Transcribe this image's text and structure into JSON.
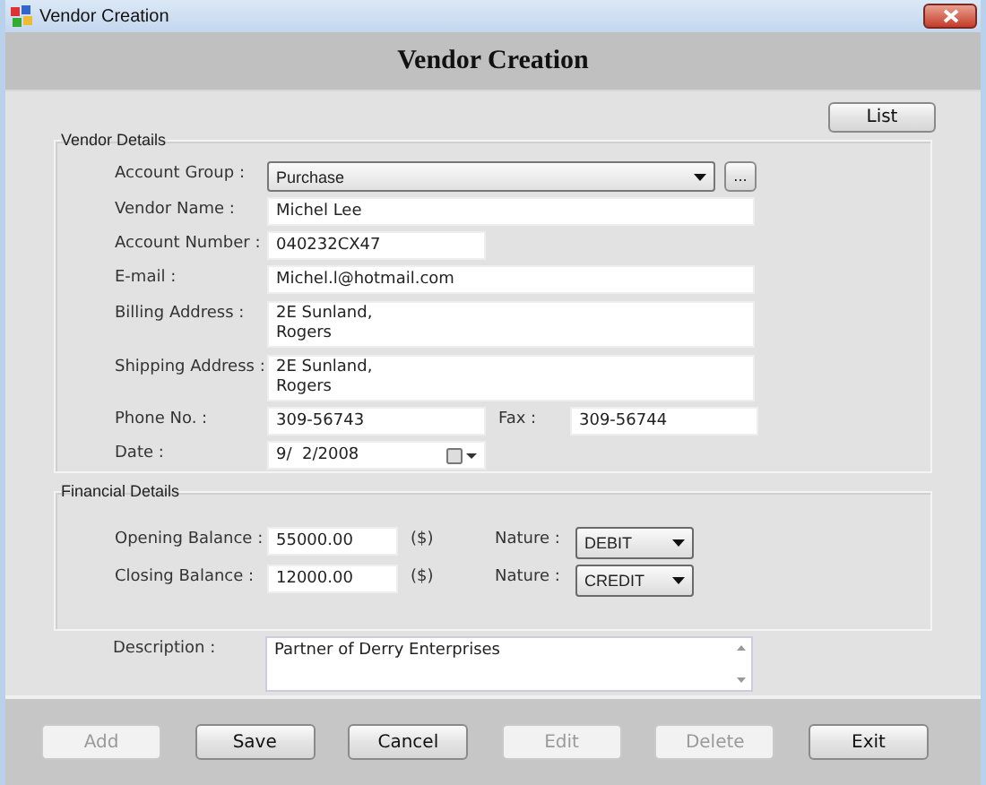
{
  "window": {
    "title": "Vendor Creation"
  },
  "header": {
    "title": "Vendor Creation"
  },
  "list_button": {
    "label": "List",
    "disabled": false
  },
  "vendor_details": {
    "legend": "Vendor Details",
    "fields": [
      {
        "kind": "combo",
        "label": "Account Group :",
        "value": "Purchase",
        "button": "..."
      },
      {
        "kind": "wide",
        "label": "Vendor Name :",
        "value": "Michel Lee"
      },
      {
        "kind": "short",
        "label": "Account Number :",
        "value": "040232CX47"
      },
      {
        "kind": "wide",
        "label": "E-mail :",
        "value": "Michel.l@hotmail.com"
      },
      {
        "kind": "multiline",
        "label": "Billing Address :",
        "value": "2E Sunland,\nRogers"
      },
      {
        "kind": "multiline",
        "label": "Shipping Address :",
        "value": "2E Sunland,\nRogers"
      },
      {
        "kind": "pair",
        "label": "Phone No. :",
        "value": "309-56743",
        "label2": "Fax :",
        "value2": "309-56744"
      },
      {
        "kind": "date",
        "label": "Date :",
        "value": "9/  2/2008"
      }
    ]
  },
  "financial_details": {
    "legend": "Financial Details",
    "rows": [
      {
        "label": "Opening Balance :",
        "value": "55000.00",
        "unit": "($)",
        "nature_label": "Nature :",
        "nature": "DEBIT"
      },
      {
        "label": "Closing Balance :",
        "value": "12000.00",
        "unit": "($)",
        "nature_label": "Nature :",
        "nature": "CREDIT"
      }
    ]
  },
  "description": {
    "label": "Description :",
    "value": "Partner of Derry Enterprises"
  },
  "buttons": [
    {
      "label": "Add",
      "disabled": true
    },
    {
      "label": "Save",
      "disabled": false
    },
    {
      "label": "Cancel",
      "disabled": false
    },
    {
      "label": "Edit",
      "disabled": true
    },
    {
      "label": "Delete",
      "disabled": true
    },
    {
      "label": "Exit",
      "disabled": false
    }
  ]
}
